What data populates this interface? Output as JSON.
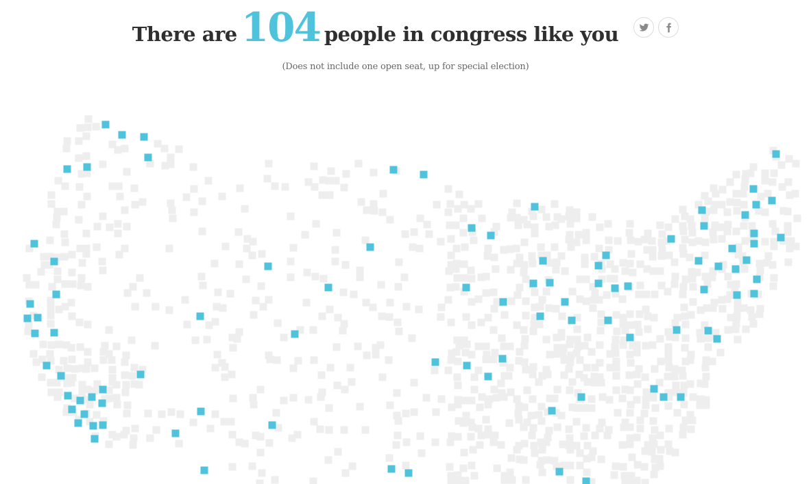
{
  "header": {
    "prefix": "There are",
    "count": "104",
    "suffix": "people in congress like you",
    "twitter_icon": "twitter-icon",
    "facebook_icon": "facebook-icon"
  },
  "note": "(Does not include one open seat, up for special election)",
  "colors": {
    "highlight": "#4ec3db",
    "base": "#eeeeee",
    "text": "#2f2f2f"
  }
}
